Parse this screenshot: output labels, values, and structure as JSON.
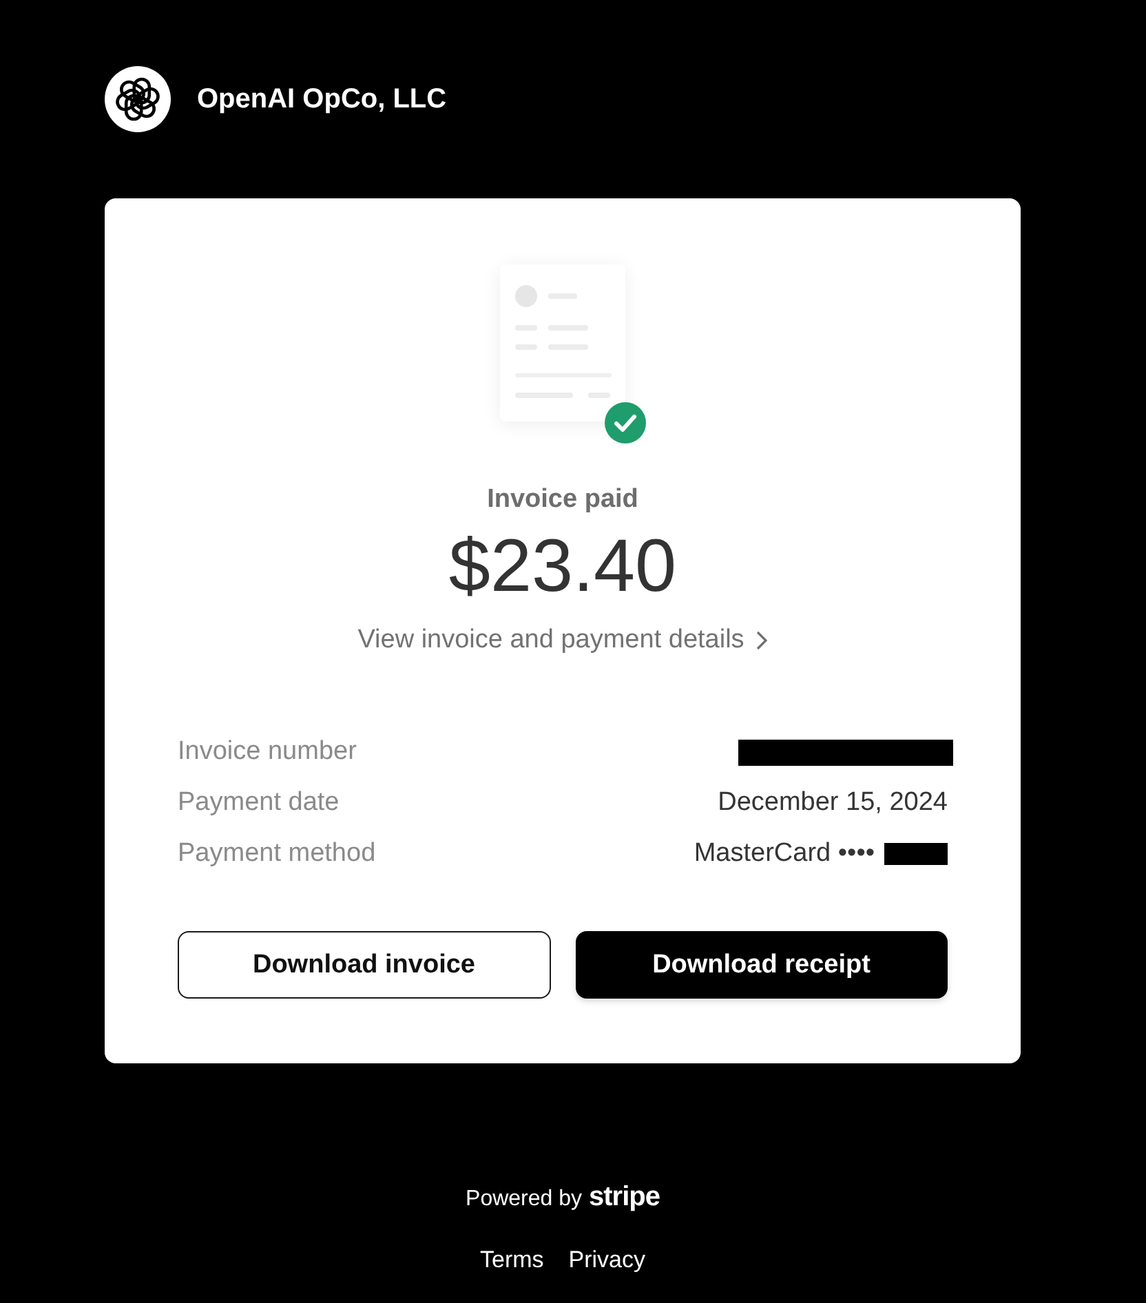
{
  "header": {
    "company": "OpenAI OpCo, LLC"
  },
  "invoice": {
    "status": "Invoice paid",
    "amount": "$23.40",
    "details_link": "View invoice and payment details"
  },
  "details": [
    {
      "label": "Invoice number",
      "redacted": true
    },
    {
      "label": "Payment date",
      "value": "December 15, 2024",
      "redacted": false
    },
    {
      "label": "Payment method",
      "value": "MasterCard ••••",
      "redacted": true
    }
  ],
  "buttons": [
    {
      "label": "Download invoice",
      "kind": "secondary"
    },
    {
      "label": "Download receipt",
      "kind": "primary"
    }
  ],
  "footer": {
    "powered_by": "Powered by",
    "brand": "stripe",
    "links": [
      "Terms",
      "Privacy"
    ]
  }
}
